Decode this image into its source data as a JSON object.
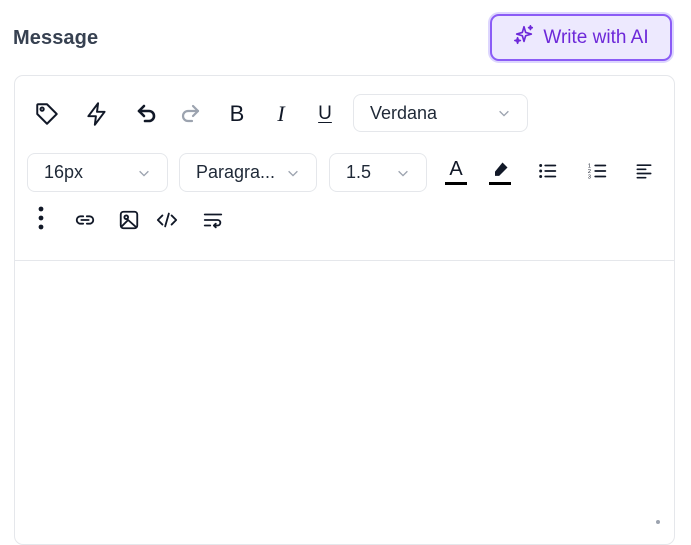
{
  "field": {
    "label": "Message"
  },
  "ai_button": {
    "label": "Write with AI",
    "icon": "sparkles-icon",
    "accent": "#7c3aed"
  },
  "toolbar": {
    "font_family": "Verdana",
    "font_size": "16px",
    "block_type": "Paragra...",
    "line_height": "1.5",
    "bold_label": "B",
    "italic_label": "I",
    "underline_label": "U",
    "text_color_label": "A"
  },
  "editor": {
    "content": ""
  }
}
